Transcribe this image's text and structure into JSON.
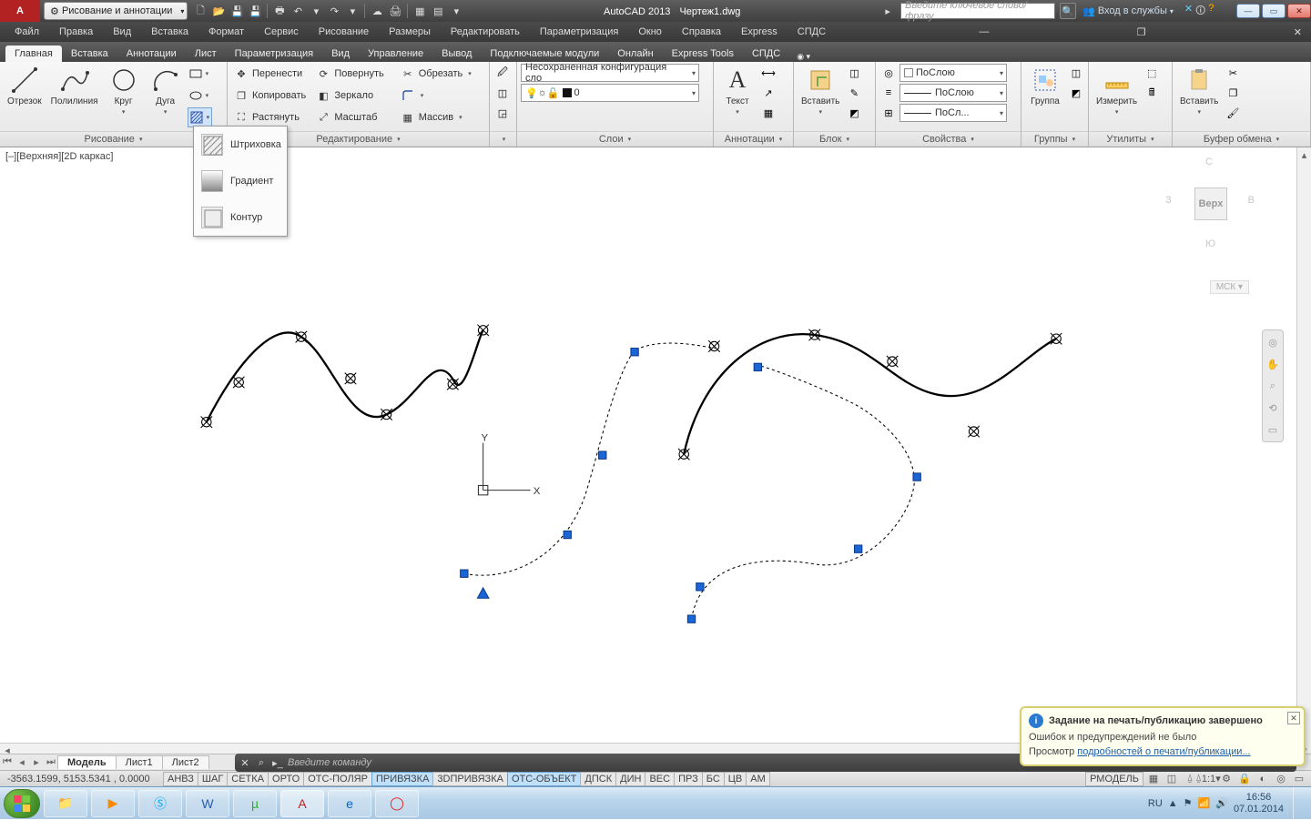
{
  "titlebar": {
    "workspace": "Рисование и аннотации",
    "app": "AutoCAD 2013",
    "file": "Чертеж1.dwg",
    "search_placeholder": "Введите ключевое слово/фразу",
    "signin": "Вход в службы"
  },
  "menubar": [
    "Файл",
    "Правка",
    "Вид",
    "Вставка",
    "Формат",
    "Сервис",
    "Рисование",
    "Размеры",
    "Редактировать",
    "Параметризация",
    "Окно",
    "Справка",
    "Express",
    "СПДС"
  ],
  "ribbon_tabs": [
    "Главная",
    "Вставка",
    "Аннотации",
    "Лист",
    "Параметризация",
    "Вид",
    "Управление",
    "Вывод",
    "Подключаемые модули",
    "Онлайн",
    "Express Tools",
    "СПДС"
  ],
  "ribbon": {
    "draw": {
      "line": "Отрезок",
      "polyline": "Полилиния",
      "circle": "Круг",
      "arc": "Дуга",
      "title": "Рисование"
    },
    "dropdown": {
      "hatch": "Штриховка",
      "gradient": "Градиент",
      "boundary": "Контур"
    },
    "modify": {
      "move": "Перенести",
      "rotate": "Повернуть",
      "trim": "Обрезать",
      "copy": "Копировать",
      "mirror": "Зеркало",
      "stretch": "Растянуть",
      "scale": "Масштаб",
      "array": "Массив",
      "title": "Редактирование"
    },
    "layers": {
      "unsaved": "Несохраненная конфигурация сло",
      "layer0": "0",
      "title": "Слои"
    },
    "annot": {
      "text": "Текст",
      "title": "Аннотации"
    },
    "block": {
      "insert": "Вставить",
      "title": "Блок"
    },
    "props": {
      "bylayer": "ПоСлою",
      "byslot": "ПоСлою",
      "bysl": "ПоСл...",
      "title": "Свойства"
    },
    "groups": {
      "group": "Группа",
      "title": "Группы"
    },
    "utils": {
      "measure": "Измерить",
      "title": "Утилиты"
    },
    "clip": {
      "paste": "Вставить",
      "title": "Буфер обмена"
    }
  },
  "view_label": "[–][Верхняя][2D каркас]",
  "viewcube": {
    "top": "Верх",
    "n": "С",
    "s": "Ю",
    "e": "В",
    "w": "З",
    "wcs": "МСК ▾"
  },
  "cmd": {
    "placeholder": "Введите команду"
  },
  "balloon": {
    "title": "Задание на печать/публикацию завершено",
    "msg": "Ошибок и предупреждений не было",
    "link_pre": "Просмотр ",
    "link": "подробностей о печати/публикации..."
  },
  "layout_tabs": [
    "Модель",
    "Лист1",
    "Лист2"
  ],
  "status": {
    "coords": "-3563.1599, 5153.5341 , 0.0000",
    "toggles": [
      "АНВЗ",
      "ШАГ",
      "СЕТКА",
      "ОРТО",
      "ОТС-ПОЛЯР",
      "ПРИВЯЗКА",
      "3DПРИВЯЗКА",
      "ОТС-ОБЪЕКТ",
      "ДПСК",
      "ДИН",
      "ВЕС",
      "ПРЗ",
      "БС",
      "ЦВ",
      "АМ"
    ],
    "toggle_states": [
      false,
      false,
      false,
      false,
      false,
      true,
      false,
      true,
      false,
      false,
      false,
      false,
      false,
      false,
      false
    ],
    "rmodel": "РМОДЕЛЬ",
    "scale": "1:1"
  },
  "tray": {
    "lang": "RU",
    "time": "16:56",
    "date": "07.01.2014"
  }
}
